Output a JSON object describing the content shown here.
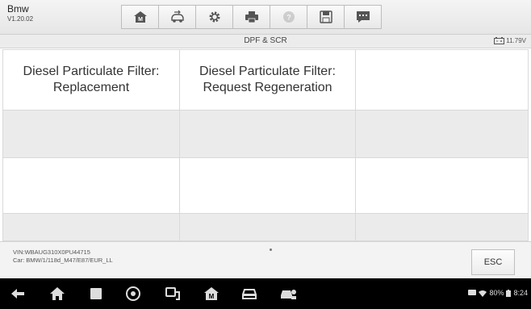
{
  "app": {
    "name": "Bmw",
    "version": "V1.20.02"
  },
  "toolbar": {
    "buttons": [
      {
        "icon": "home-icon"
      },
      {
        "icon": "vehicle-swap-icon"
      },
      {
        "icon": "settings-icon"
      },
      {
        "icon": "print-icon"
      },
      {
        "icon": "help-icon",
        "disabled": true
      },
      {
        "icon": "save-icon"
      },
      {
        "icon": "data-logging-icon"
      }
    ]
  },
  "title": {
    "text": "DPF & SCR",
    "voltage": "11.79V"
  },
  "grid": {
    "cells": [
      [
        "Diesel Particulate Filter: Replacement",
        "Diesel Particulate Filter: Request Regeneration",
        ""
      ],
      [
        "",
        "",
        ""
      ],
      [
        "",
        "",
        ""
      ],
      [
        "",
        "",
        ""
      ]
    ]
  },
  "footer": {
    "vin": "VIN:WBAUG310X0PU44715",
    "car": "Car: BMW/1/118d_M47/E87/EUR_LL",
    "esc_label": "ESC"
  },
  "navbar": {
    "icons": [
      "back-icon",
      "home-icon",
      "recent-apps-icon",
      "browser-icon",
      "vci-icon",
      "maxisys-home-icon",
      "car-icon",
      "vehicle-menu-icon"
    ]
  },
  "status": {
    "battery_percent": "80%",
    "time": "8:24"
  },
  "colors": {
    "nav_bg": "#000000",
    "row_shade": "#ebebeb",
    "topbar": "#efefef"
  }
}
